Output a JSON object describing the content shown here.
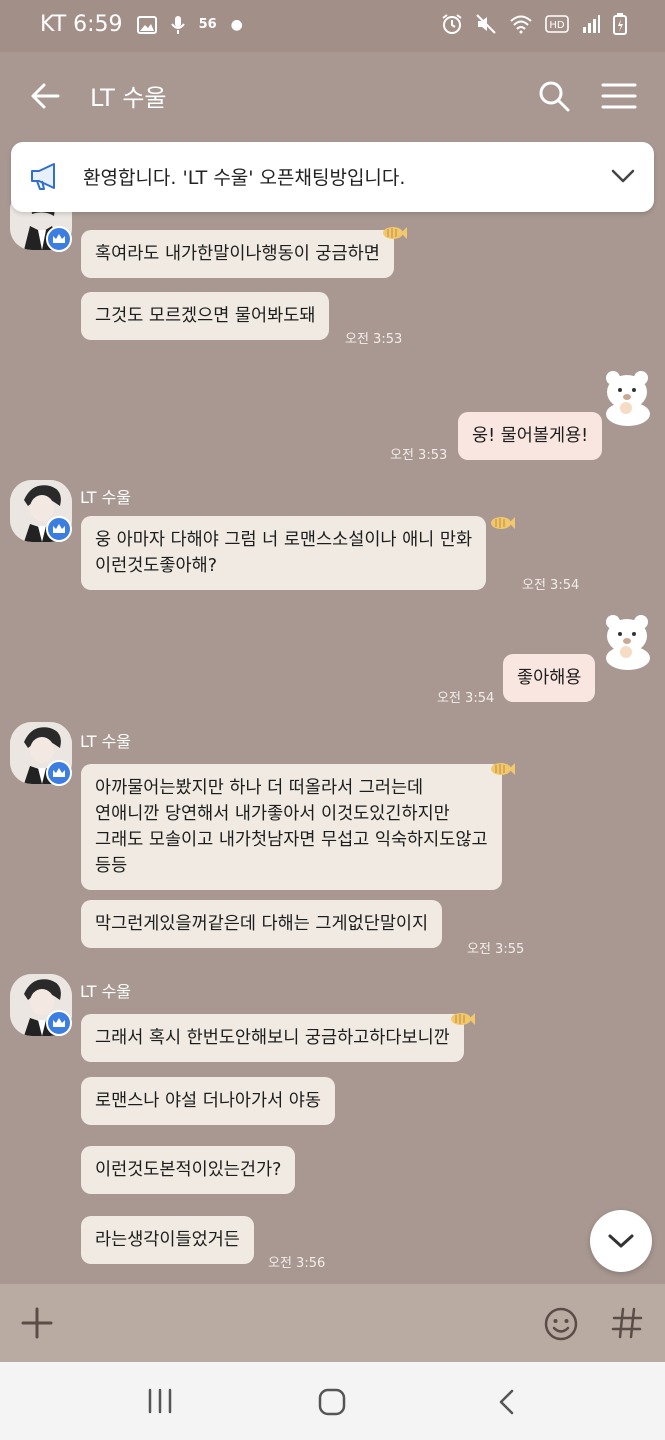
{
  "status_bar": {
    "carrier_time": "KT 6:59",
    "network": "56",
    "icons": [
      "image-icon",
      "mic-icon",
      "alarm-icon",
      "mute-icon",
      "wifi-icon",
      "hd-icon",
      "signal-icon",
      "battery-icon"
    ]
  },
  "header": {
    "title": "LT 수울"
  },
  "notice": {
    "text": "환영합니다. 'LT 수울' 오픈채팅방입니다."
  },
  "sender_name": "LT 수울",
  "messages": {
    "m1": "혹여라도 내가한말이나행동이 궁금하면",
    "m2": "그것도 모르겠으면 물어봐도돼",
    "m2_time": "오전 3:53",
    "mine1": "웅! 물어볼게용!",
    "mine1_time": "오전 3:53",
    "m3_line1": "웅 아마자 다해야 그럼 너 로맨스소설이나 애니 만화",
    "m3_line2": "이런것도좋아해?",
    "m3_time": "오전 3:54",
    "mine2": "좋아해용",
    "mine2_time": "오전 3:54",
    "m4_line1": "아까물어는봤지만 하나 더 떠올라서 그러는데",
    "m4_line2": "연애니깐 당연해서 내가좋아서 이것도있긴하지만",
    "m4_line3": "그래도 모솔이고 내가첫남자면 무섭고 익숙하지도않고",
    "m4_line4": "등등",
    "m5": "막그런게있을꺼같은데 다해는 그게없단말이지",
    "m5_time": "오전 3:55",
    "m6": "그래서 혹시 한번도안해보니 궁금하고하다보니깐",
    "m7": "로맨스나 야설 더나아가서 야동",
    "m8": "이런것도본적이있는건가?",
    "m9": "라는생각이들었거든",
    "m9_time": "오전 3:56"
  },
  "colors": {
    "background": "#a89891",
    "incoming_bubble": "#f0eae2",
    "outgoing_bubble": "#fae6e1",
    "crown_badge": "#3b7de0"
  }
}
